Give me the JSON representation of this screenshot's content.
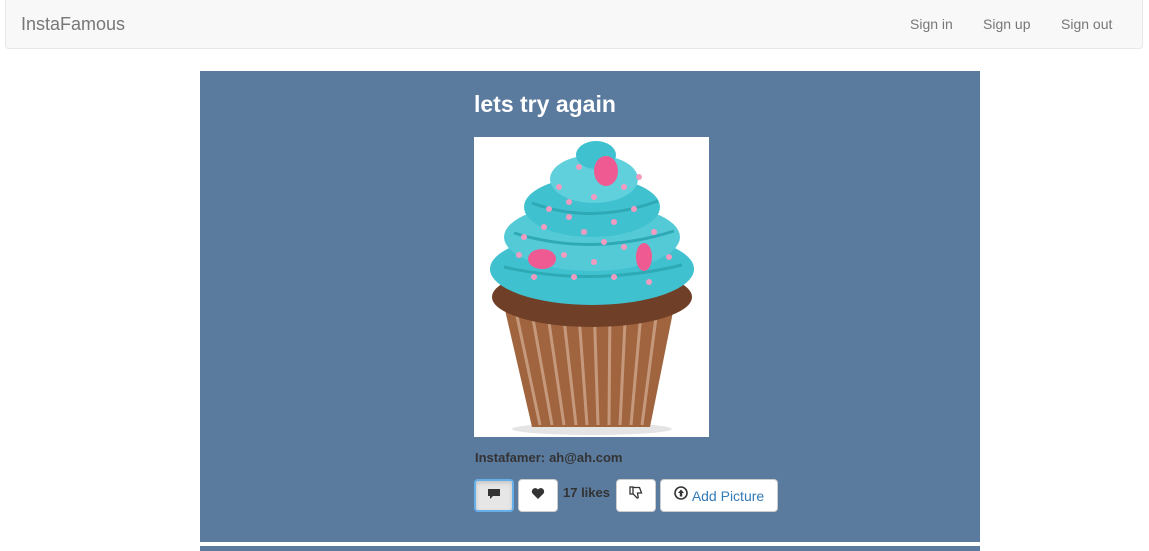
{
  "nav": {
    "brand": "InstaFamous",
    "links": [
      "Sign in",
      "Sign up",
      "Sign out"
    ]
  },
  "post": {
    "title": "lets try again",
    "image_subject": "cupcake with turquoise frosting and pink sprinkles",
    "owner_label": "Instafamer:",
    "owner_email": "ah@ah.com",
    "likes_text": "17 likes",
    "add_picture_label": "Add Picture"
  },
  "icons": {
    "comment": "comment-icon",
    "like": "heart-icon",
    "unlike": "thumbs-down-icon",
    "upload": "upload-circle-icon"
  },
  "colors": {
    "panel": "#5a7a9e",
    "navbar": "#f8f8f8",
    "link": "#337ab7",
    "frosting": "#3fc1cf"
  }
}
